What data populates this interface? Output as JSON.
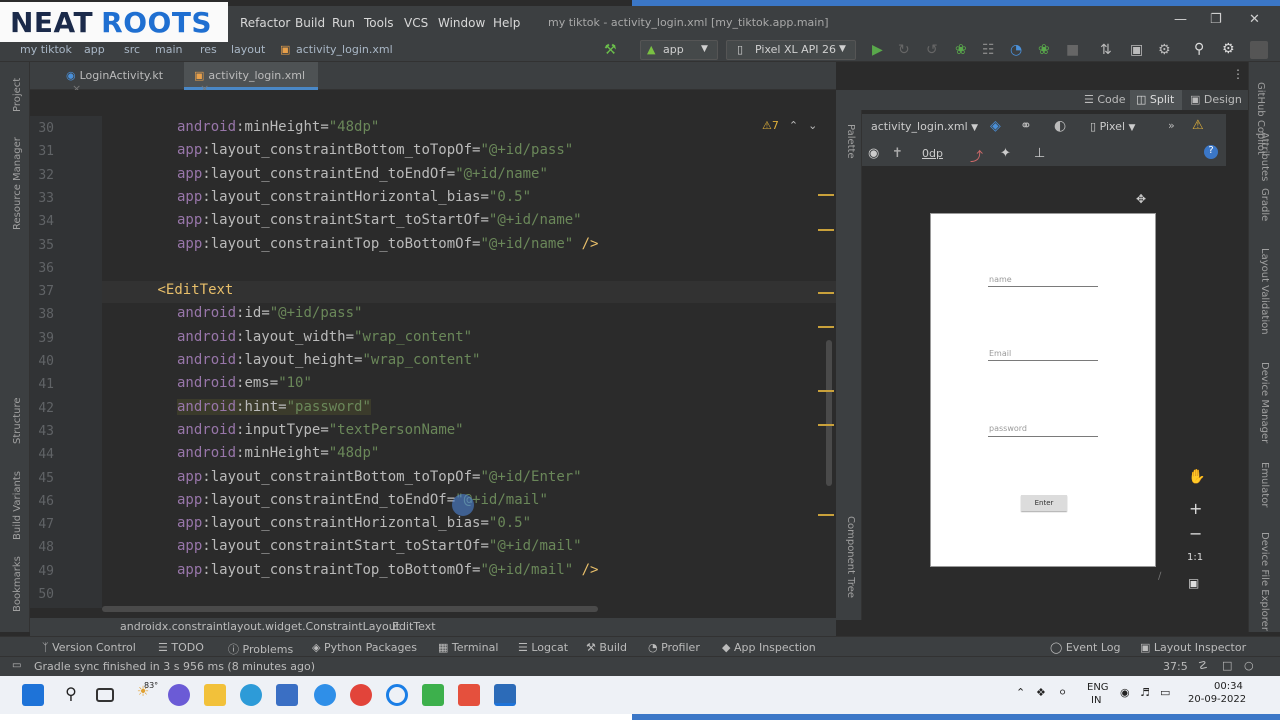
{
  "logo": {
    "word1": "NEAT",
    "word2": "ROOTS"
  },
  "menu": {
    "items": [
      "Refactor",
      "Build",
      "Run",
      "Tools",
      "VCS",
      "Window",
      "Help"
    ],
    "window_title": "my tiktok - activity_login.xml [my_tiktok.app.main]"
  },
  "nav": {
    "crumbs": [
      "my tiktok",
      "app",
      "src",
      "main",
      "res",
      "layout",
      "activity_login.xml"
    ],
    "run_config": "app",
    "device_config": "Pixel XL API 26"
  },
  "tabs": [
    {
      "label": "LoginActivity.kt"
    },
    {
      "label": "activity_login.xml"
    }
  ],
  "left_strip": [
    "Project",
    "Resource Manager",
    "Structure",
    "Build Variants",
    "Bookmarks"
  ],
  "right_strip": [
    "GitHub Copilot",
    "Attributes",
    "Gradle",
    "Layout Validation",
    "Device Manager",
    "Emulator",
    "Device File Explorer"
  ],
  "editor": {
    "warning_count": "7",
    "lines": [
      {
        "n": "30",
        "indent": 2,
        "ns": "android",
        "attr": "minHeight",
        "val": "\"48dp\"",
        "end": ""
      },
      {
        "n": "31",
        "indent": 2,
        "ns": "app",
        "attr": "layout_constraintBottom_toTopOf",
        "val": "\"@+id/pass\"",
        "end": ""
      },
      {
        "n": "32",
        "indent": 2,
        "ns": "app",
        "attr": "layout_constraintEnd_toEndOf",
        "val": "\"@+id/name\"",
        "end": ""
      },
      {
        "n": "33",
        "indent": 2,
        "ns": "app",
        "attr": "layout_constraintHorizontal_bias",
        "val": "\"0.5\"",
        "end": ""
      },
      {
        "n": "34",
        "indent": 2,
        "ns": "app",
        "attr": "layout_constraintStart_toStartOf",
        "val": "\"@+id/name\"",
        "end": ""
      },
      {
        "n": "35",
        "indent": 2,
        "ns": "app",
        "attr": "layout_constraintTop_toBottomOf",
        "val": "\"@+id/name\"",
        "end": " />"
      },
      {
        "n": "36",
        "indent": 0,
        "ns": "",
        "attr": "",
        "val": "",
        "end": ""
      },
      {
        "n": "37",
        "indent": 1,
        "tag": "<EditText",
        "ns": "",
        "attr": "",
        "val": "",
        "end": ""
      },
      {
        "n": "38",
        "indent": 2,
        "ns": "android",
        "attr": "id",
        "val": "\"@+id/pass\"",
        "end": ""
      },
      {
        "n": "39",
        "indent": 2,
        "ns": "android",
        "attr": "layout_width",
        "val": "\"wrap_content\"",
        "end": ""
      },
      {
        "n": "40",
        "indent": 2,
        "ns": "android",
        "attr": "layout_height",
        "val": "\"wrap_content\"",
        "end": ""
      },
      {
        "n": "41",
        "indent": 2,
        "ns": "android",
        "attr": "ems",
        "val": "\"10\"",
        "end": ""
      },
      {
        "n": "42",
        "indent": 2,
        "ns": "android",
        "attr": "hint",
        "val": "\"password\"",
        "end": "",
        "highlight": true
      },
      {
        "n": "43",
        "indent": 2,
        "ns": "android",
        "attr": "inputType",
        "val": "\"textPersonName\"",
        "end": ""
      },
      {
        "n": "44",
        "indent": 2,
        "ns": "android",
        "attr": "minHeight",
        "val": "\"48dp\"",
        "end": ""
      },
      {
        "n": "45",
        "indent": 2,
        "ns": "app",
        "attr": "layout_constraintBottom_toTopOf",
        "val": "\"@+id/Enter\"",
        "end": ""
      },
      {
        "n": "46",
        "indent": 2,
        "ns": "app",
        "attr": "layout_constraintEnd_toEndOf",
        "val": "\"@+id/mail\"",
        "end": ""
      },
      {
        "n": "47",
        "indent": 2,
        "ns": "app",
        "attr": "layout_constraintHorizontal_bias",
        "val": "\"0.5\"",
        "end": ""
      },
      {
        "n": "48",
        "indent": 2,
        "ns": "app",
        "attr": "layout_constraintStart_toStartOf",
        "val": "\"@+id/mail\"",
        "end": ""
      },
      {
        "n": "49",
        "indent": 2,
        "ns": "app",
        "attr": "layout_constraintTop_toBottomOf",
        "val": "\"@+id/mail\"",
        "end": " />"
      },
      {
        "n": "50",
        "indent": 0,
        "ns": "",
        "attr": "",
        "val": "",
        "end": ""
      }
    ]
  },
  "split": {
    "code": "Code",
    "split": "Split",
    "design": "Design"
  },
  "design": {
    "file": "activity_login.xml",
    "margin": "0dp",
    "device": "Pixel",
    "palette": "Palette",
    "component_tree": "Component Tree",
    "zoom_ratio": "1:1",
    "preview": {
      "fields": [
        {
          "hint": "name"
        },
        {
          "hint": "Email"
        },
        {
          "hint": "password"
        }
      ],
      "button": "Enter"
    }
  },
  "breadcrumb": [
    "androidx.constraintlayout.widget.ConstraintLayout",
    "EditText"
  ],
  "tools": [
    "Version Control",
    "TODO",
    "Problems",
    "Python Packages",
    "Terminal",
    "Logcat",
    "Build",
    "Profiler",
    "App Inspection",
    "Event Log",
    "Layout Inspector"
  ],
  "status": {
    "message": "Gradle sync finished in 3 s 956 ms (8 minutes ago)",
    "position": "37:5"
  },
  "taskbar": {
    "weather": "83°",
    "lang1": "ENG",
    "lang2": "IN",
    "time": "00:34",
    "date": "20-09-2022"
  },
  "colors": {
    "accent": "#3b77c7",
    "tag": "#e8bf6a",
    "value": "#6a8759",
    "namespace": "#9876aa",
    "warning": "#e0b03a"
  }
}
